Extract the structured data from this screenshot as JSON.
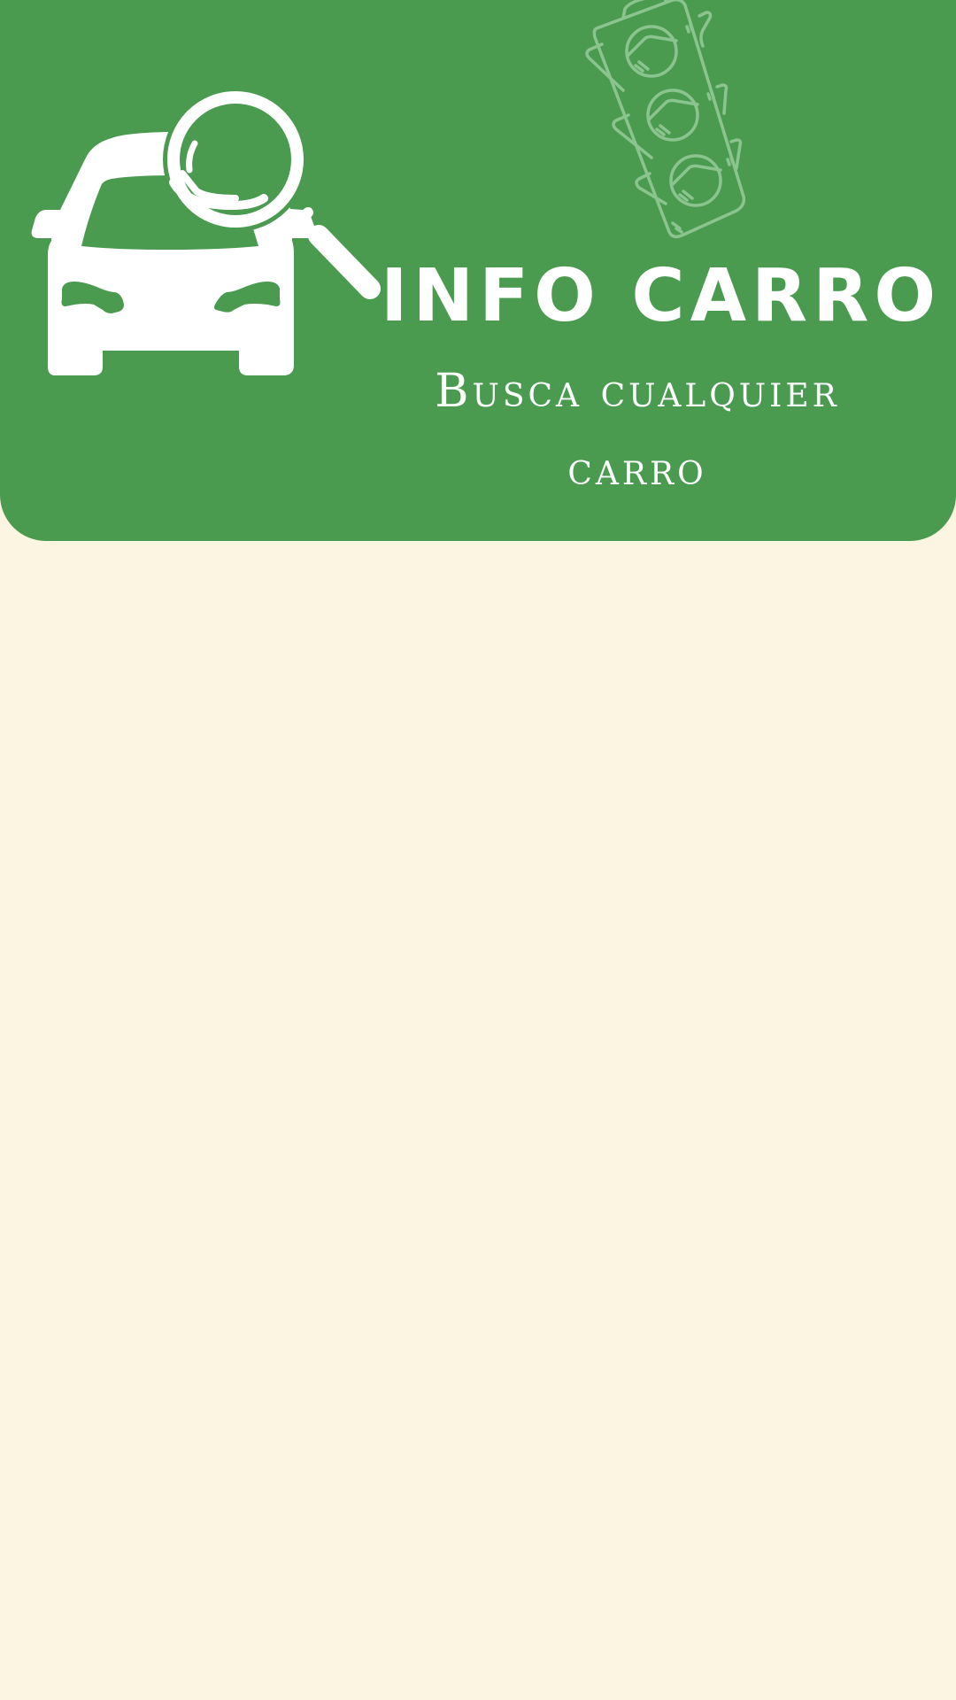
{
  "colors": {
    "header_background": "#4A9B50",
    "page_background": "#FCF5E1",
    "logo_foreground": "#FFFFFF",
    "decoration_stroke": "#8CC48F"
  },
  "header": {
    "logo_icon": "car-search-icon",
    "decoration_icon": "traffic-light-icon",
    "title": "INFO CARRO",
    "subtitle": "Busca cualquier carro"
  }
}
